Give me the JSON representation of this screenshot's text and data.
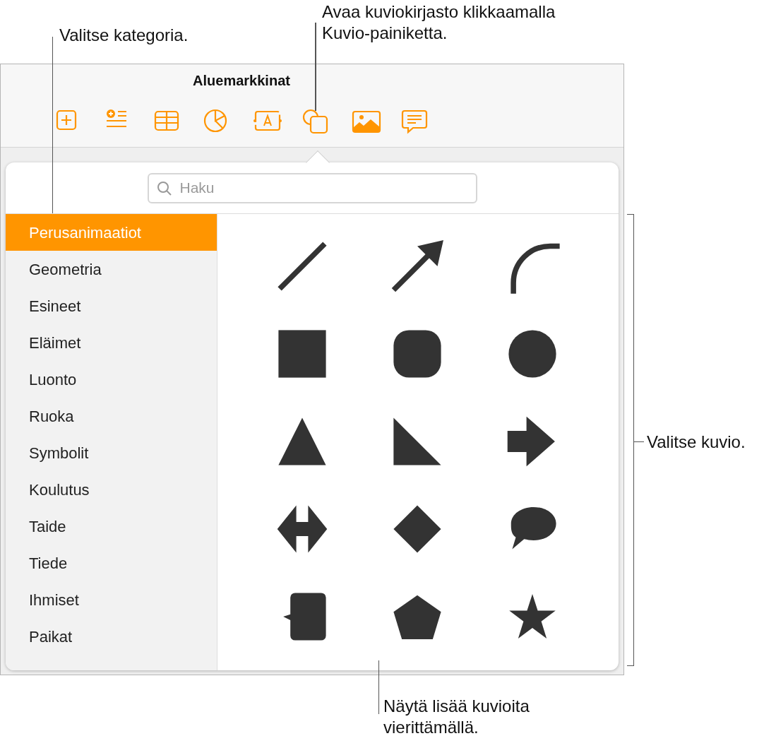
{
  "window": {
    "title": "Aluemarkkinat"
  },
  "toolbar": [
    {
      "kind": "add"
    },
    {
      "kind": "list"
    },
    {
      "kind": "table"
    },
    {
      "kind": "chart"
    },
    {
      "kind": "text"
    },
    {
      "kind": "shape"
    },
    {
      "kind": "media"
    },
    {
      "kind": "comment"
    }
  ],
  "search": {
    "placeholder": "Haku"
  },
  "categories": [
    {
      "label": "Perusanimaatiot",
      "selected": true
    },
    {
      "label": "Geometria",
      "selected": false
    },
    {
      "label": "Esineet",
      "selected": false
    },
    {
      "label": "Eläimet",
      "selected": false
    },
    {
      "label": "Luonto",
      "selected": false
    },
    {
      "label": "Ruoka",
      "selected": false
    },
    {
      "label": "Symbolit",
      "selected": false
    },
    {
      "label": "Koulutus",
      "selected": false
    },
    {
      "label": "Taide",
      "selected": false
    },
    {
      "label": "Tiede",
      "selected": false
    },
    {
      "label": "Ihmiset",
      "selected": false
    },
    {
      "label": "Paikat",
      "selected": false
    }
  ],
  "shapes": [
    {
      "kind": "line"
    },
    {
      "kind": "arrow"
    },
    {
      "kind": "arc"
    },
    {
      "kind": "square"
    },
    {
      "kind": "rounded-square"
    },
    {
      "kind": "circle"
    },
    {
      "kind": "triangle"
    },
    {
      "kind": "right-triangle"
    },
    {
      "kind": "right-arrow"
    },
    {
      "kind": "double-arrow"
    },
    {
      "kind": "diamond"
    },
    {
      "kind": "speech-bubble"
    },
    {
      "kind": "callout"
    },
    {
      "kind": "pentagon"
    },
    {
      "kind": "star"
    }
  ],
  "callouts": [
    {
      "kind": "category",
      "text": "Valitse kategoria."
    },
    {
      "kind": "library",
      "text": "Avaa kuviokirjasto klikkaamalla Kuvio-painiketta."
    },
    {
      "kind": "shape",
      "text": "Valitse kuvio."
    },
    {
      "kind": "scroll",
      "text": "Näytä lisää kuvioita vierittämällä."
    }
  ]
}
